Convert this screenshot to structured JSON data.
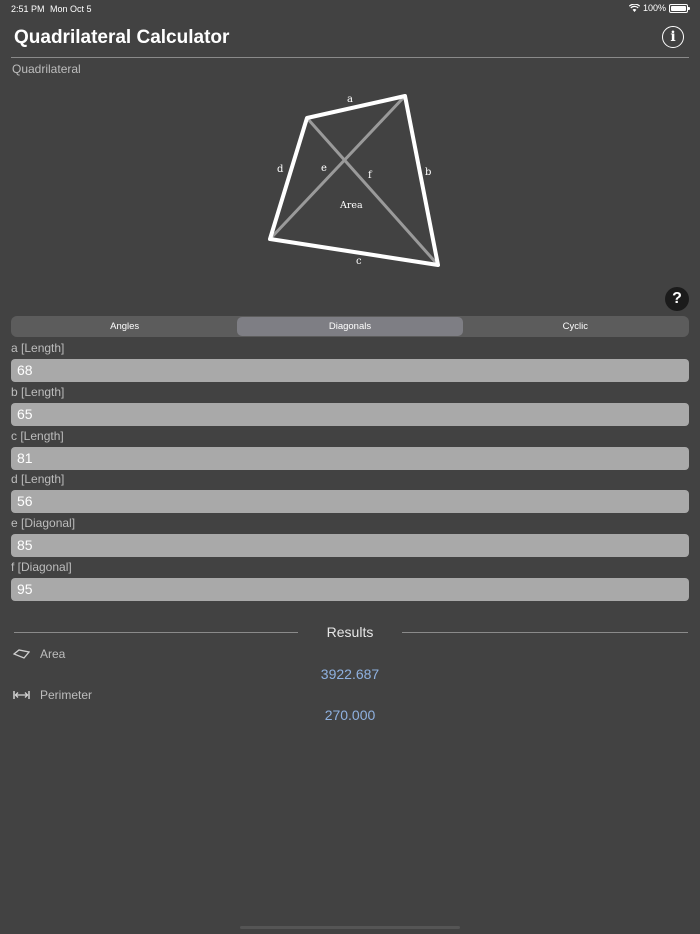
{
  "status": {
    "time": "2:51 PM",
    "date": "Mon Oct 5",
    "battery": "100%"
  },
  "header": {
    "title": "Quadrilateral Calculator",
    "info_icon": "info-icon"
  },
  "section_label": "Quadrilateral",
  "diagram": {
    "labels": {
      "a": "a",
      "b": "b",
      "c": "c",
      "d": "d",
      "e": "e",
      "f": "f",
      "area": "Area"
    }
  },
  "tabs": [
    {
      "label": "Angles",
      "active": false
    },
    {
      "label": "Diagonals",
      "active": true
    },
    {
      "label": "Cyclic",
      "active": false
    }
  ],
  "fields": [
    {
      "label": "a [Length]",
      "value": "68"
    },
    {
      "label": "b [Length]",
      "value": "65"
    },
    {
      "label": "c [Length]",
      "value": "81"
    },
    {
      "label": "d [Length]",
      "value": "56"
    },
    {
      "label": "e [Diagonal]",
      "value": "85"
    },
    {
      "label": "f [Diagonal]",
      "value": "95"
    }
  ],
  "results": {
    "title": "Results",
    "area": {
      "label": "Area",
      "value": "3922.687"
    },
    "perimeter": {
      "label": "Perimeter",
      "value": "270.000"
    }
  },
  "colors": {
    "background": "#424242",
    "accent_value": "#8fb1e0",
    "input_fill": "#a9a9a9"
  }
}
